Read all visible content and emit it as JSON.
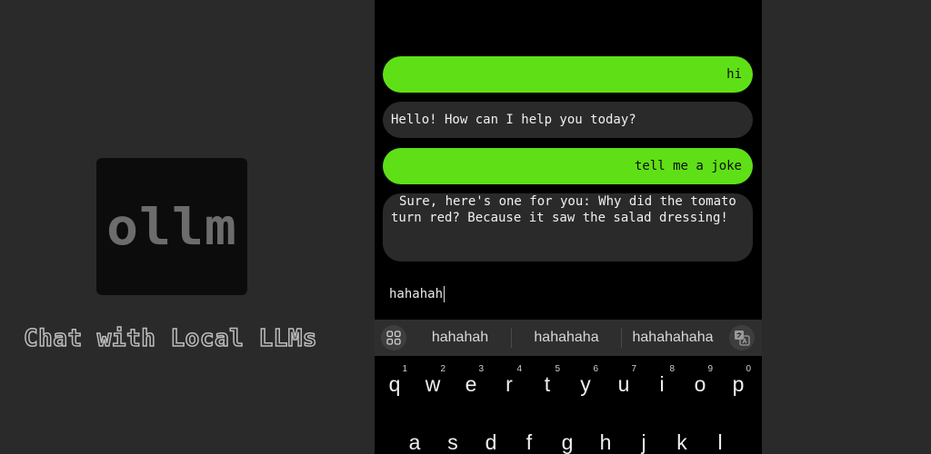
{
  "promo": {
    "logo_text": "ollm",
    "tagline": "Chat with Local LLMs"
  },
  "messages": [
    {
      "role": "user",
      "text": "hi"
    },
    {
      "role": "assistant",
      "text": "Hello! How can I help you today?"
    },
    {
      "role": "user",
      "text": "tell me a joke"
    },
    {
      "role": "assistant",
      "text": "Sure, here's one for you: Why did the tomato turn red? Because it saw the salad dressing!"
    }
  ],
  "input": {
    "value": "hahahah"
  },
  "suggestions": [
    "hahahah",
    "hahahaha",
    "hahahahaha"
  ],
  "keyboard": {
    "row1": [
      {
        "key": "q",
        "hint": "1"
      },
      {
        "key": "w",
        "hint": "2"
      },
      {
        "key": "e",
        "hint": "3"
      },
      {
        "key": "r",
        "hint": "4"
      },
      {
        "key": "t",
        "hint": "5"
      },
      {
        "key": "y",
        "hint": "6"
      },
      {
        "key": "u",
        "hint": "7"
      },
      {
        "key": "i",
        "hint": "8"
      },
      {
        "key": "o",
        "hint": "9"
      },
      {
        "key": "p",
        "hint": "0"
      }
    ],
    "row2": [
      "a",
      "s",
      "d",
      "f",
      "g",
      "h",
      "j",
      "k",
      "l"
    ]
  },
  "colors": {
    "accent": "#5fe016",
    "bot_bubble": "#2a2a2a",
    "background": "#000000"
  },
  "icons": {
    "suggest_left": "apps-grid-icon",
    "suggest_right": "translate-icon"
  }
}
